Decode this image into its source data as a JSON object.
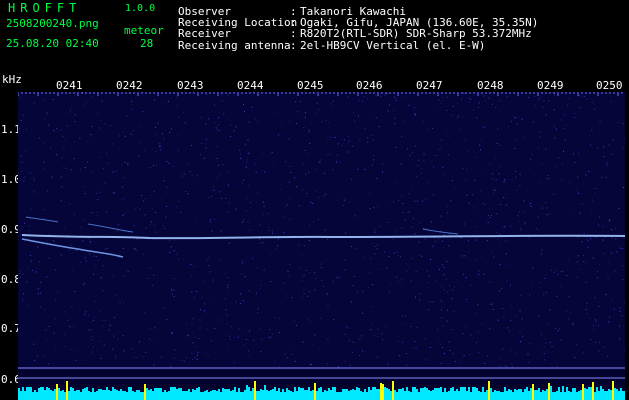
{
  "header": {
    "app_title": "HROFFT",
    "version": "1.0.0",
    "file_name": "2508200240.png",
    "date_time": "25.08.20 02:40",
    "meteor_label": "meteor",
    "meteor_count": "28"
  },
  "info": [
    {
      "label": "Observer",
      "sep": ":",
      "value": "Takanori Kawachi"
    },
    {
      "label": "Receiving Location",
      "sep": ":",
      "value": "Ogaki, Gifu, JAPAN (136.60E, 35.35N)"
    },
    {
      "label": "Receiver",
      "sep": ":",
      "value": "R820T2(RTL-SDR) SDR-Sharp 53.372MHz"
    },
    {
      "label": "Receiving antenna",
      "sep": ":",
      "value": "2el-HB9CV Vertical (el. E-W)"
    }
  ],
  "axis": {
    "unit": "kHz",
    "time_ticks": [
      "0241",
      "0242",
      "0243",
      "0244",
      "0245",
      "0246",
      "0247",
      "0248",
      "0249",
      "0250"
    ],
    "freq_ticks": [
      "1.1",
      "1.0",
      "0.9",
      "0.8",
      "0.7",
      "0.6"
    ]
  },
  "colors": {
    "label_green": "#00ff40",
    "text_white": "#ffffff",
    "background": "#05053a",
    "signal": "#a0c8ff",
    "level_cyan": "#00e8ff",
    "level_yellow": "#ffff00"
  }
}
